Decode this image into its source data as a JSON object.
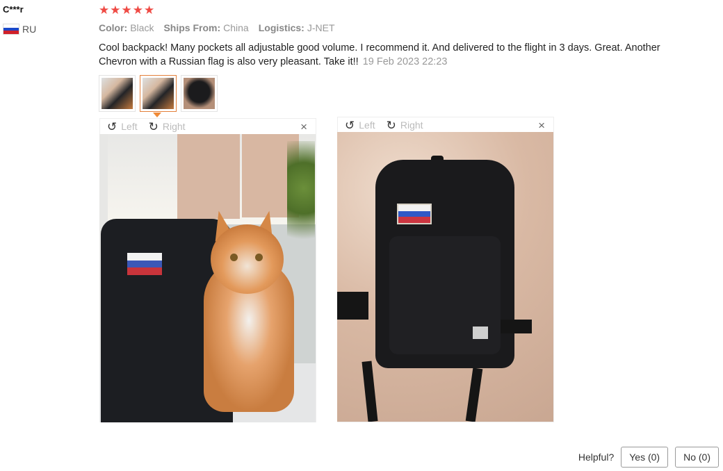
{
  "user": {
    "name": "C***r",
    "country": "RU"
  },
  "rating": {
    "stars": 5
  },
  "attributes": [
    {
      "label": "Color:",
      "value": "Black"
    },
    {
      "label": "Ships From:",
      "value": "China"
    },
    {
      "label": "Logistics:",
      "value": "J-NET"
    }
  ],
  "review": {
    "text": "Cool backpack! Many pockets all adjustable good volume. I recommend it. And delivered to the flight in 3 days. Great. Another Chevron with a Russian flag is also very pleasant. Take it!!",
    "date": "19 Feb 2023 22:23"
  },
  "viewer": {
    "left_label": "Left",
    "right_label": "Right",
    "close_glyph": "×",
    "rotate_left_icon": "↺",
    "rotate_right_icon": "↻"
  },
  "thumbnails": [
    "cat-with-backpack",
    "cat-with-backpack",
    "backpack"
  ],
  "helpful": {
    "label": "Helpful?",
    "yes": "Yes (0)",
    "no": "No (0)"
  },
  "colors": {
    "star": "#ef4a44",
    "active_thumb_border": "#e4803a"
  }
}
